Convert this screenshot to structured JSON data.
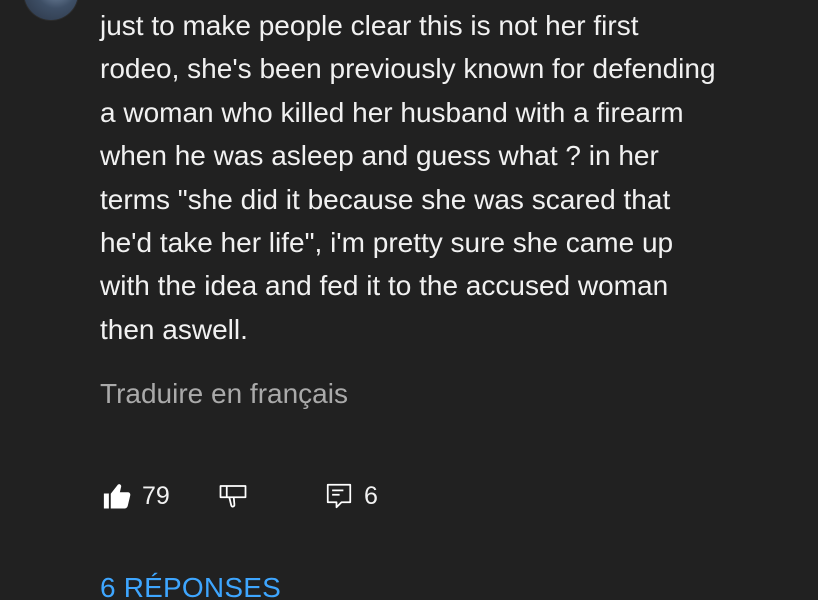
{
  "comment": {
    "lines": [
      "just to make people clear this is not her first",
      "rodeo, she's been previously known for defending",
      "a woman who killed her husband with a firearm",
      "when he was asleep and guess what ? in her",
      "terms \"she did it because she was scared that",
      "he'd take her life\", i'm pretty sure she came up",
      "with the idea and fed it to the accused woman",
      "then aswell."
    ],
    "translate_label": "Traduire en français"
  },
  "actions": {
    "like_count": "79",
    "reply_count": "6",
    "icons": {
      "like": "thumbs-up-filled-icon",
      "dislike": "thumbs-down-outline-icon",
      "reply": "comment-reply-icon"
    }
  },
  "replies": {
    "label": "6 RÉPONSES"
  },
  "colors": {
    "background": "#212121",
    "text": "#f1f1f1",
    "muted": "#aaaaaa",
    "link": "#3ea6ff"
  }
}
